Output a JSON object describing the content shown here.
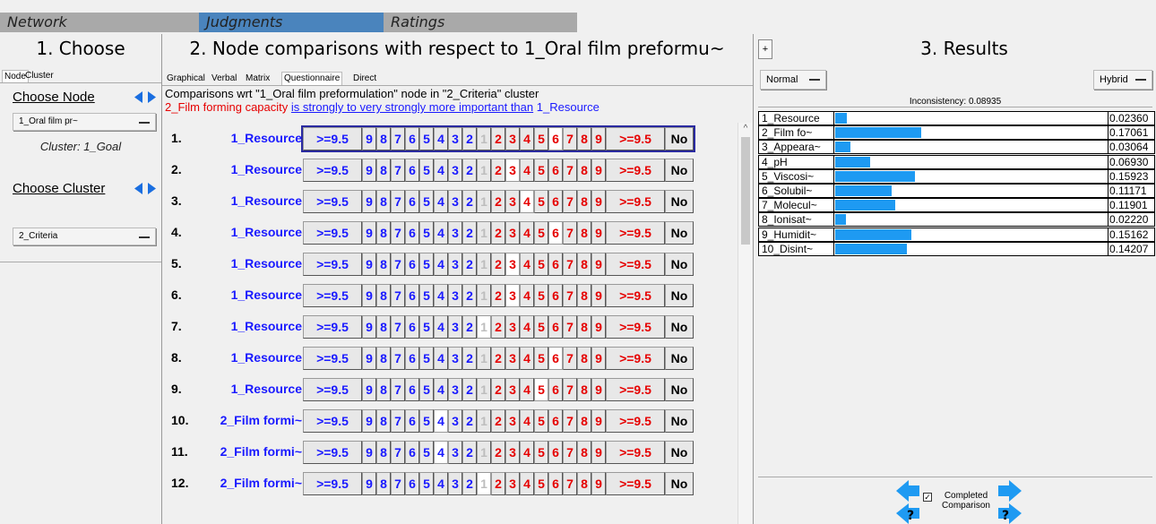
{
  "menu": {
    "network": "Network",
    "judgments": "Judgments",
    "ratings": "Ratings"
  },
  "headers": {
    "choose": "1. Choose",
    "comparisons": "2. Node comparisons with respect to 1_Oral film preformu~",
    "results": "3. Results",
    "plus": "+"
  },
  "left": {
    "tabs": [
      "Node",
      "Cluster"
    ],
    "choose_node": "Choose Node",
    "node_value": "1_Oral film pr~",
    "cluster_info": "Cluster: 1_Goal",
    "choose_cluster": "Choose Cluster",
    "cluster_value": "2_Criteria"
  },
  "middle": {
    "tabs": [
      "Graphical",
      "Verbal",
      "Matrix",
      "Questionnaire",
      "Direct"
    ],
    "line1": "Comparisons wrt \"1_Oral film preformulation\" node in \"2_Criteria\" cluster",
    "line2a": "2_Film forming capacity",
    "line2b": "is strongly to very strongly more important than",
    "line2c": "1_Resource",
    "scale_left": [
      ">=9.5",
      "9",
      "8",
      "7",
      "6",
      "5",
      "4",
      "3",
      "2"
    ],
    "scale_mid": "1",
    "scale_right": [
      "2",
      "3",
      "4",
      "5",
      "6",
      "7",
      "8",
      "9",
      ">=9.5"
    ],
    "no": "No",
    "rows": [
      {
        "num": "1.",
        "name": "1_Resource",
        "sel": "R6"
      },
      {
        "num": "2.",
        "name": "1_Resource",
        "sel": "R3"
      },
      {
        "num": "3.",
        "name": "1_Resource",
        "sel": "R4"
      },
      {
        "num": "4.",
        "name": "1_Resource",
        "sel": "R6"
      },
      {
        "num": "5.",
        "name": "1_Resource",
        "sel": "R3"
      },
      {
        "num": "6.",
        "name": "1_Resource",
        "sel": "R3"
      },
      {
        "num": "7.",
        "name": "1_Resource",
        "sel": "M1"
      },
      {
        "num": "8.",
        "name": "1_Resource",
        "sel": "R6"
      },
      {
        "num": "9.",
        "name": "1_Resource",
        "sel": "R5"
      },
      {
        "num": "10.",
        "name": "2_Film formi~",
        "sel": "L4"
      },
      {
        "num": "11.",
        "name": "2_Film formi~",
        "sel": "L4"
      },
      {
        "num": "12.",
        "name": "2_Film formi~",
        "sel": "M1"
      }
    ]
  },
  "results": {
    "normal": "Normal",
    "hybrid": "Hybrid",
    "inconsistency": "Inconsistency: 0.08935",
    "items": [
      {
        "name": "1_Resource",
        "value": "0.02360",
        "frac": 0.0236
      },
      {
        "name": "2_Film fo~",
        "value": "0.17061",
        "frac": 0.17061
      },
      {
        "name": "3_Appeara~",
        "value": "0.03064",
        "frac": 0.03064
      },
      {
        "name": "4_pH",
        "value": "0.06930",
        "frac": 0.0693
      },
      {
        "name": "5_Viscosi~",
        "value": "0.15923",
        "frac": 0.15923
      },
      {
        "name": "6_Solubil~",
        "value": "0.11171",
        "frac": 0.11171
      },
      {
        "name": "7_Molecul~",
        "value": "0.11901",
        "frac": 0.11901
      },
      {
        "name": "8_Ionisat~",
        "value": "0.02220",
        "frac": 0.0222
      },
      {
        "name": "9_Humidit~",
        "value": "0.15162",
        "frac": 0.15162
      },
      {
        "name": "10_Disint~",
        "value": "0.14207",
        "frac": 0.14207
      }
    ],
    "completed_label": "Completed\nComparison",
    "completed_checked": true,
    "bar_color": "#1e9af2"
  }
}
